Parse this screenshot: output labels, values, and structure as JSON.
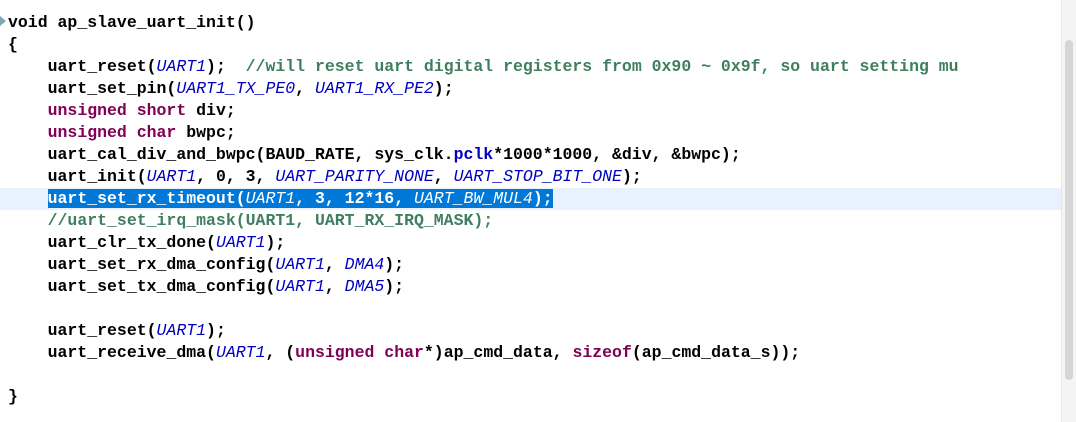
{
  "editor": {
    "lines": [
      {
        "tokens": [
          {
            "t": "void ",
            "c": "plain"
          },
          {
            "t": "ap_slave_uart_init()",
            "c": "plain"
          }
        ]
      },
      {
        "tokens": [
          {
            "t": "{",
            "c": "plain"
          }
        ]
      },
      {
        "tokens": [
          {
            "t": "    uart_reset(",
            "c": "plain"
          },
          {
            "t": "UART1",
            "c": "const"
          },
          {
            "t": ");  ",
            "c": "plain"
          },
          {
            "t": "//will reset uart digital registers from 0x90 ~ 0x9f, so uart setting mu",
            "c": "cmt"
          }
        ]
      },
      {
        "tokens": [
          {
            "t": "    uart_set_pin(",
            "c": "plain"
          },
          {
            "t": "UART1_TX_PE0",
            "c": "const"
          },
          {
            "t": ", ",
            "c": "plain"
          },
          {
            "t": "UART1_RX_PE2",
            "c": "const"
          },
          {
            "t": ");",
            "c": "plain"
          }
        ]
      },
      {
        "tokens": [
          {
            "t": "    ",
            "c": "plain"
          },
          {
            "t": "unsigned short",
            "c": "kw"
          },
          {
            "t": " div;",
            "c": "plain"
          }
        ]
      },
      {
        "tokens": [
          {
            "t": "    ",
            "c": "plain"
          },
          {
            "t": "unsigned char",
            "c": "kw"
          },
          {
            "t": " bwpc;",
            "c": "plain"
          }
        ]
      },
      {
        "tokens": [
          {
            "t": "    uart_cal_div_and_bwpc(BAUD_RATE, sys_clk.",
            "c": "plain"
          },
          {
            "t": "pclk",
            "c": "field"
          },
          {
            "t": "*1000*1000, &div, &bwpc);",
            "c": "plain"
          }
        ]
      },
      {
        "tokens": [
          {
            "t": "    uart_init(",
            "c": "plain"
          },
          {
            "t": "UART1",
            "c": "const"
          },
          {
            "t": ", 0, 3, ",
            "c": "plain"
          },
          {
            "t": "UART_PARITY_NONE",
            "c": "const"
          },
          {
            "t": ", ",
            "c": "plain"
          },
          {
            "t": "UART_STOP_BIT_ONE",
            "c": "const"
          },
          {
            "t": ");",
            "c": "plain"
          }
        ]
      },
      {
        "current": true,
        "tokens": [
          {
            "t": "    ",
            "c": "plain"
          },
          {
            "t": "uart_set_rx_timeout(",
            "c": "sel"
          },
          {
            "t": "UART1",
            "c": "sel-const"
          },
          {
            "t": ", 3, 12*16, ",
            "c": "sel"
          },
          {
            "t": "UART_BW_MUL4",
            "c": "sel-const"
          },
          {
            "t": ");",
            "c": "sel"
          }
        ]
      },
      {
        "tokens": [
          {
            "t": "    ",
            "c": "plain"
          },
          {
            "t": "//uart_set_irq_mask(UART1, UART_RX_IRQ_MASK);",
            "c": "cmt"
          }
        ]
      },
      {
        "tokens": [
          {
            "t": "    uart_clr_tx_done(",
            "c": "plain"
          },
          {
            "t": "UART1",
            "c": "const"
          },
          {
            "t": ");",
            "c": "plain"
          }
        ]
      },
      {
        "tokens": [
          {
            "t": "    uart_set_rx_dma_config(",
            "c": "plain"
          },
          {
            "t": "UART1",
            "c": "const"
          },
          {
            "t": ", ",
            "c": "plain"
          },
          {
            "t": "DMA4",
            "c": "const"
          },
          {
            "t": ");",
            "c": "plain"
          }
        ]
      },
      {
        "tokens": [
          {
            "t": "    uart_set_tx_dma_config(",
            "c": "plain"
          },
          {
            "t": "UART1",
            "c": "const"
          },
          {
            "t": ", ",
            "c": "plain"
          },
          {
            "t": "DMA5",
            "c": "const"
          },
          {
            "t": ");",
            "c": "plain"
          }
        ]
      },
      {
        "tokens": [
          {
            "t": "",
            "c": "plain"
          }
        ]
      },
      {
        "tokens": [
          {
            "t": "    uart_reset(",
            "c": "plain"
          },
          {
            "t": "UART1",
            "c": "const"
          },
          {
            "t": ");",
            "c": "plain"
          }
        ]
      },
      {
        "tokens": [
          {
            "t": "    uart_receive_dma(",
            "c": "plain"
          },
          {
            "t": "UART1",
            "c": "const"
          },
          {
            "t": ", (",
            "c": "plain"
          },
          {
            "t": "unsigned char",
            "c": "kw"
          },
          {
            "t": "*)ap_cmd_data, ",
            "c": "plain"
          },
          {
            "t": "sizeof",
            "c": "kw"
          },
          {
            "t": "(ap_cmd_data_s));",
            "c": "plain"
          }
        ]
      },
      {
        "tokens": [
          {
            "t": "",
            "c": "plain"
          }
        ]
      },
      {
        "tokens": [
          {
            "t": "}",
            "c": "plain"
          }
        ]
      }
    ]
  },
  "colors": {
    "keyword": "#7f0055",
    "constant": "#0000c0",
    "comment": "#3f7f5f",
    "selection": "#0078d7",
    "current_line": "#e8f2fe"
  }
}
